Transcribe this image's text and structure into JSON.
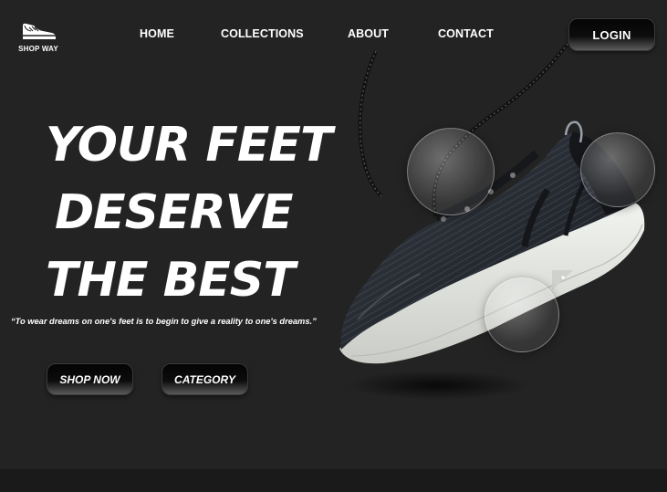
{
  "brand": {
    "name": "SHOP WAY",
    "logo_icon": "sneaker-icon"
  },
  "nav": {
    "items": [
      {
        "label": "HOME"
      },
      {
        "label": "COLLECTIONS"
      },
      {
        "label": "ABOUT"
      },
      {
        "label": "CONTACT"
      }
    ],
    "login_label": "LOGIN"
  },
  "hero": {
    "title_lines": [
      "YOUR FEET",
      "DESERVE",
      "THE BEST"
    ],
    "quote": "“To wear dreams on one's feet is to begin to give a reality to one's dreams.”",
    "buttons": {
      "shop_now": "SHOP NOW",
      "category": "CATEGORY"
    }
  },
  "colors": {
    "background": "#232323",
    "text": "#ffffff",
    "button_dark": "#050505",
    "sole": "#e6e9e4",
    "upper": "#2b2f37"
  }
}
